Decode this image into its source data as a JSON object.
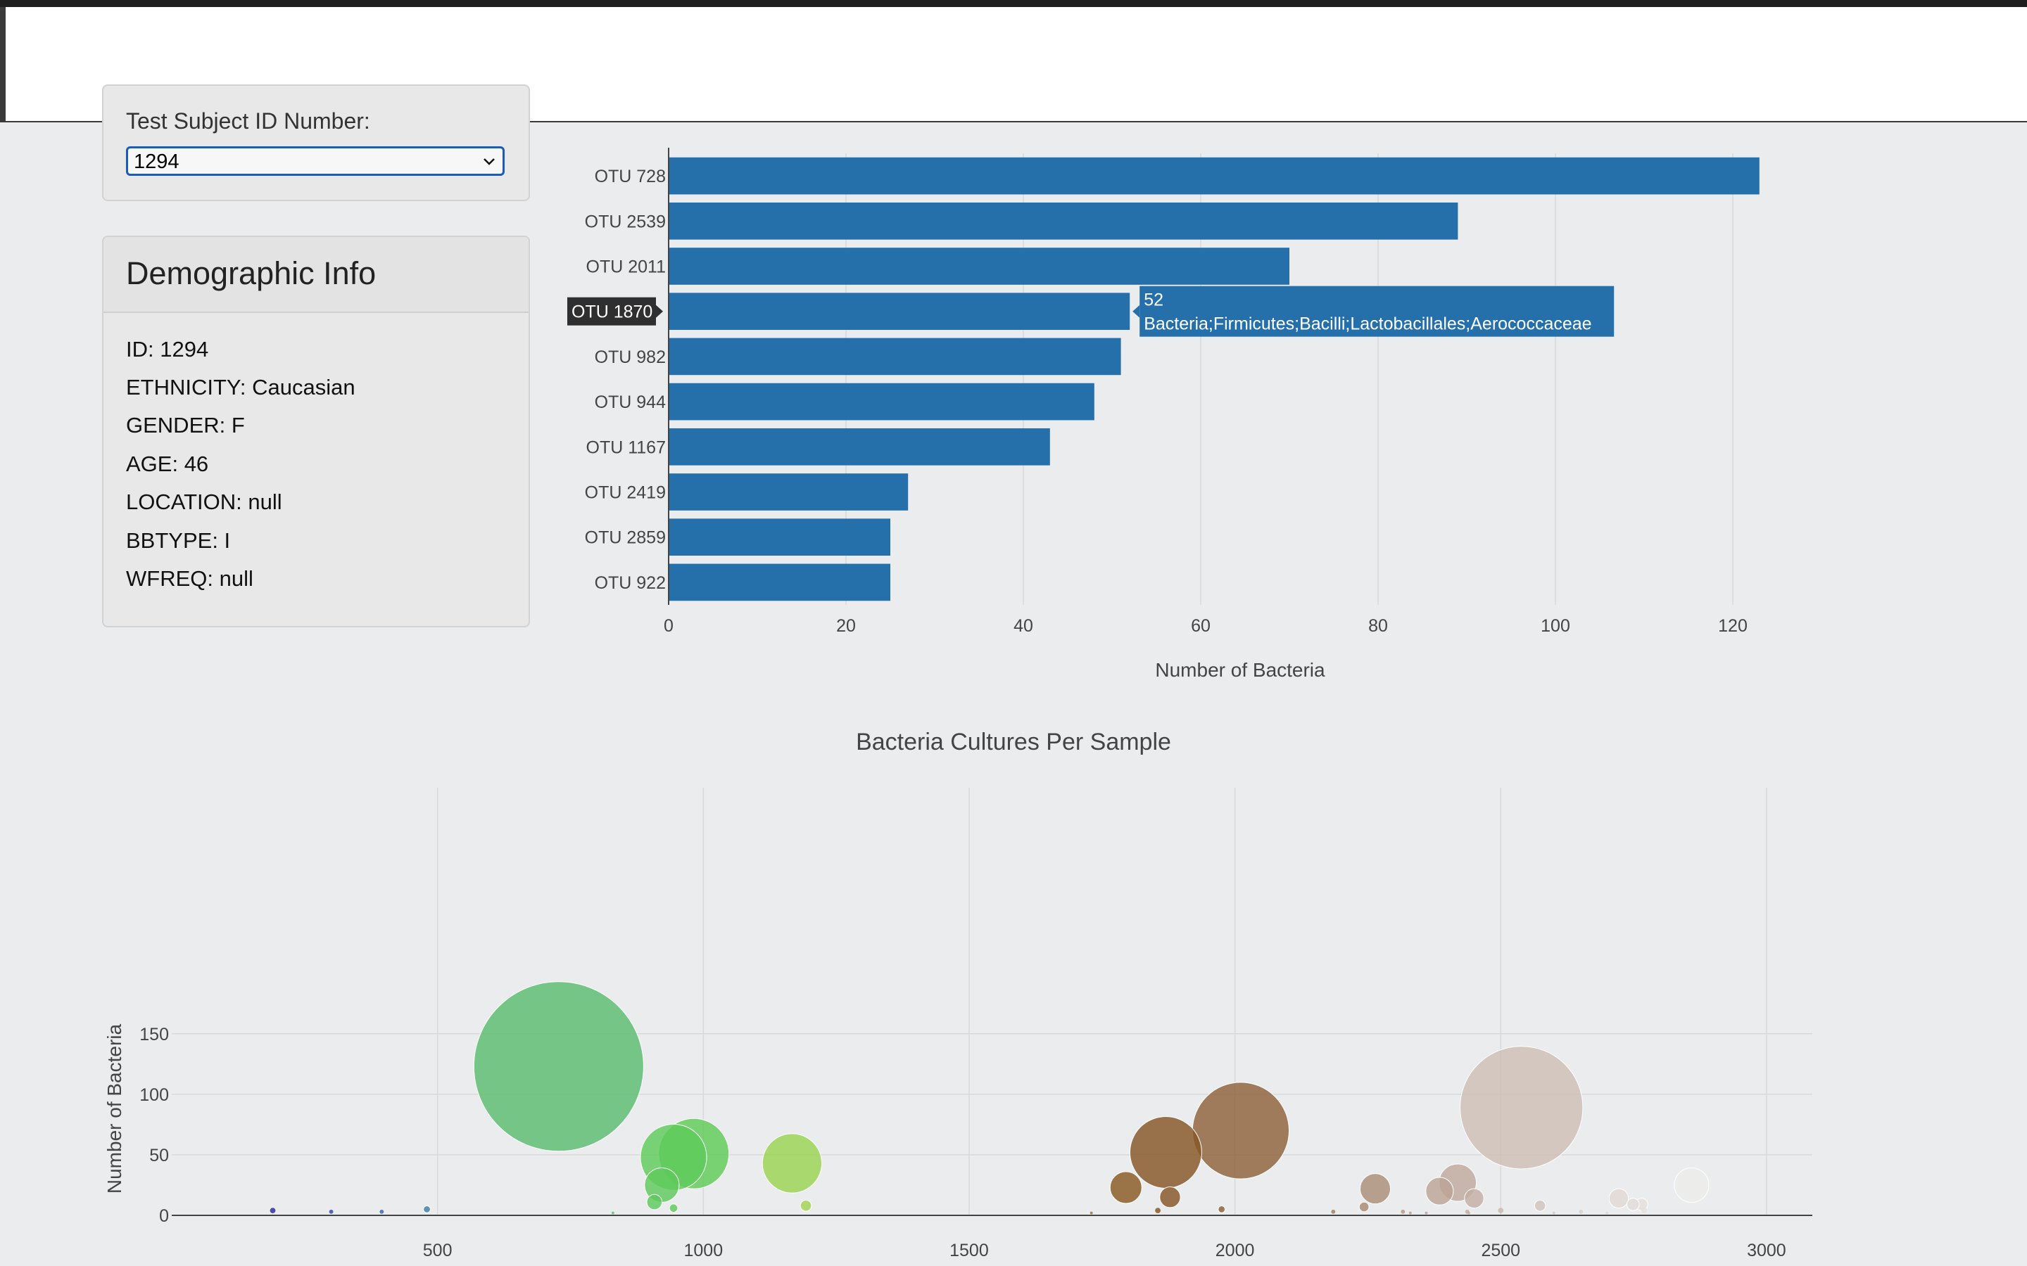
{
  "selector": {
    "label": "Test Subject ID Number:",
    "value": "1294"
  },
  "demographic": {
    "title": "Demographic Info",
    "lines": [
      "ID: 1294",
      "ETHNICITY: Caucasian",
      "GENDER: F",
      "AGE: 46",
      "LOCATION: null",
      "BBTYPE: I",
      "WFREQ: null"
    ]
  },
  "colors": {
    "bar": "#2570aa",
    "hover_label_bg": "#2f2f2f",
    "grid": "#d9d9d9",
    "axis": "#444444"
  },
  "chart_data": [
    {
      "type": "bar",
      "orientation": "horizontal",
      "title": "",
      "xlabel": "Number of Bacteria",
      "ylabel": "",
      "xlim": [
        0,
        125
      ],
      "xticks": [
        0,
        20,
        40,
        60,
        80,
        100,
        120
      ],
      "categories": [
        "OTU 728",
        "OTU 2539",
        "OTU 2011",
        "OTU 1870",
        "OTU 982",
        "OTU 944",
        "OTU 1167",
        "OTU 2419",
        "OTU 2859",
        "OTU 922"
      ],
      "values": [
        123,
        89,
        70,
        52,
        51,
        48,
        43,
        27,
        25,
        25
      ],
      "grid": true,
      "hover": {
        "category": "OTU 1870",
        "value_text": "52",
        "label_text": "Bacteria;Firmicutes;Bacilli;Lactobacillales;Aerococcaceae"
      }
    },
    {
      "type": "scatter",
      "variant": "bubble",
      "title": "Bacteria Cultures Per Sample",
      "xlabel": "",
      "ylabel": "Number of Bacteria",
      "xlim": [
        0,
        3110
      ],
      "ylim": [
        0,
        177
      ],
      "xticks": [
        500,
        1000,
        1500,
        2000,
        2500,
        3000
      ],
      "yticks": [
        0,
        50,
        100,
        150
      ],
      "grid": true,
      "colorscale": "Earth",
      "points": [
        {
          "x": 728,
          "y": 123
        },
        {
          "x": 2539,
          "y": 89
        },
        {
          "x": 2011,
          "y": 70
        },
        {
          "x": 1870,
          "y": 52
        },
        {
          "x": 982,
          "y": 51
        },
        {
          "x": 944,
          "y": 48
        },
        {
          "x": 1167,
          "y": 43
        },
        {
          "x": 2419,
          "y": 27
        },
        {
          "x": 2859,
          "y": 25
        },
        {
          "x": 922,
          "y": 25
        },
        {
          "x": 2264,
          "y": 22
        },
        {
          "x": 1795,
          "y": 23
        },
        {
          "x": 2385,
          "y": 20
        },
        {
          "x": 1878,
          "y": 15
        },
        {
          "x": 2722,
          "y": 14
        },
        {
          "x": 2450,
          "y": 14
        },
        {
          "x": 908,
          "y": 11
        },
        {
          "x": 2765,
          "y": 9
        },
        {
          "x": 2749,
          "y": 9
        },
        {
          "x": 1193,
          "y": 8
        },
        {
          "x": 2574,
          "y": 8
        },
        {
          "x": 2243,
          "y": 7
        },
        {
          "x": 944,
          "y": 6
        },
        {
          "x": 480,
          "y": 5
        },
        {
          "x": 1975,
          "y": 5
        },
        {
          "x": 1855,
          "y": 4
        },
        {
          "x": 190,
          "y": 4
        },
        {
          "x": 2500,
          "y": 4
        },
        {
          "x": 2770,
          "y": 4
        },
        {
          "x": 300,
          "y": 3
        },
        {
          "x": 395,
          "y": 3
        },
        {
          "x": 2185,
          "y": 3
        },
        {
          "x": 2316,
          "y": 3
        },
        {
          "x": 2437,
          "y": 3
        },
        {
          "x": 2651,
          "y": 3
        },
        {
          "x": 2330,
          "y": 2
        },
        {
          "x": 2360,
          "y": 2
        },
        {
          "x": 2600,
          "y": 2
        },
        {
          "x": 2700,
          "y": 2
        },
        {
          "x": 2440,
          "y": 2
        },
        {
          "x": 830,
          "y": 2
        },
        {
          "x": 1730,
          "y": 2
        }
      ]
    }
  ]
}
